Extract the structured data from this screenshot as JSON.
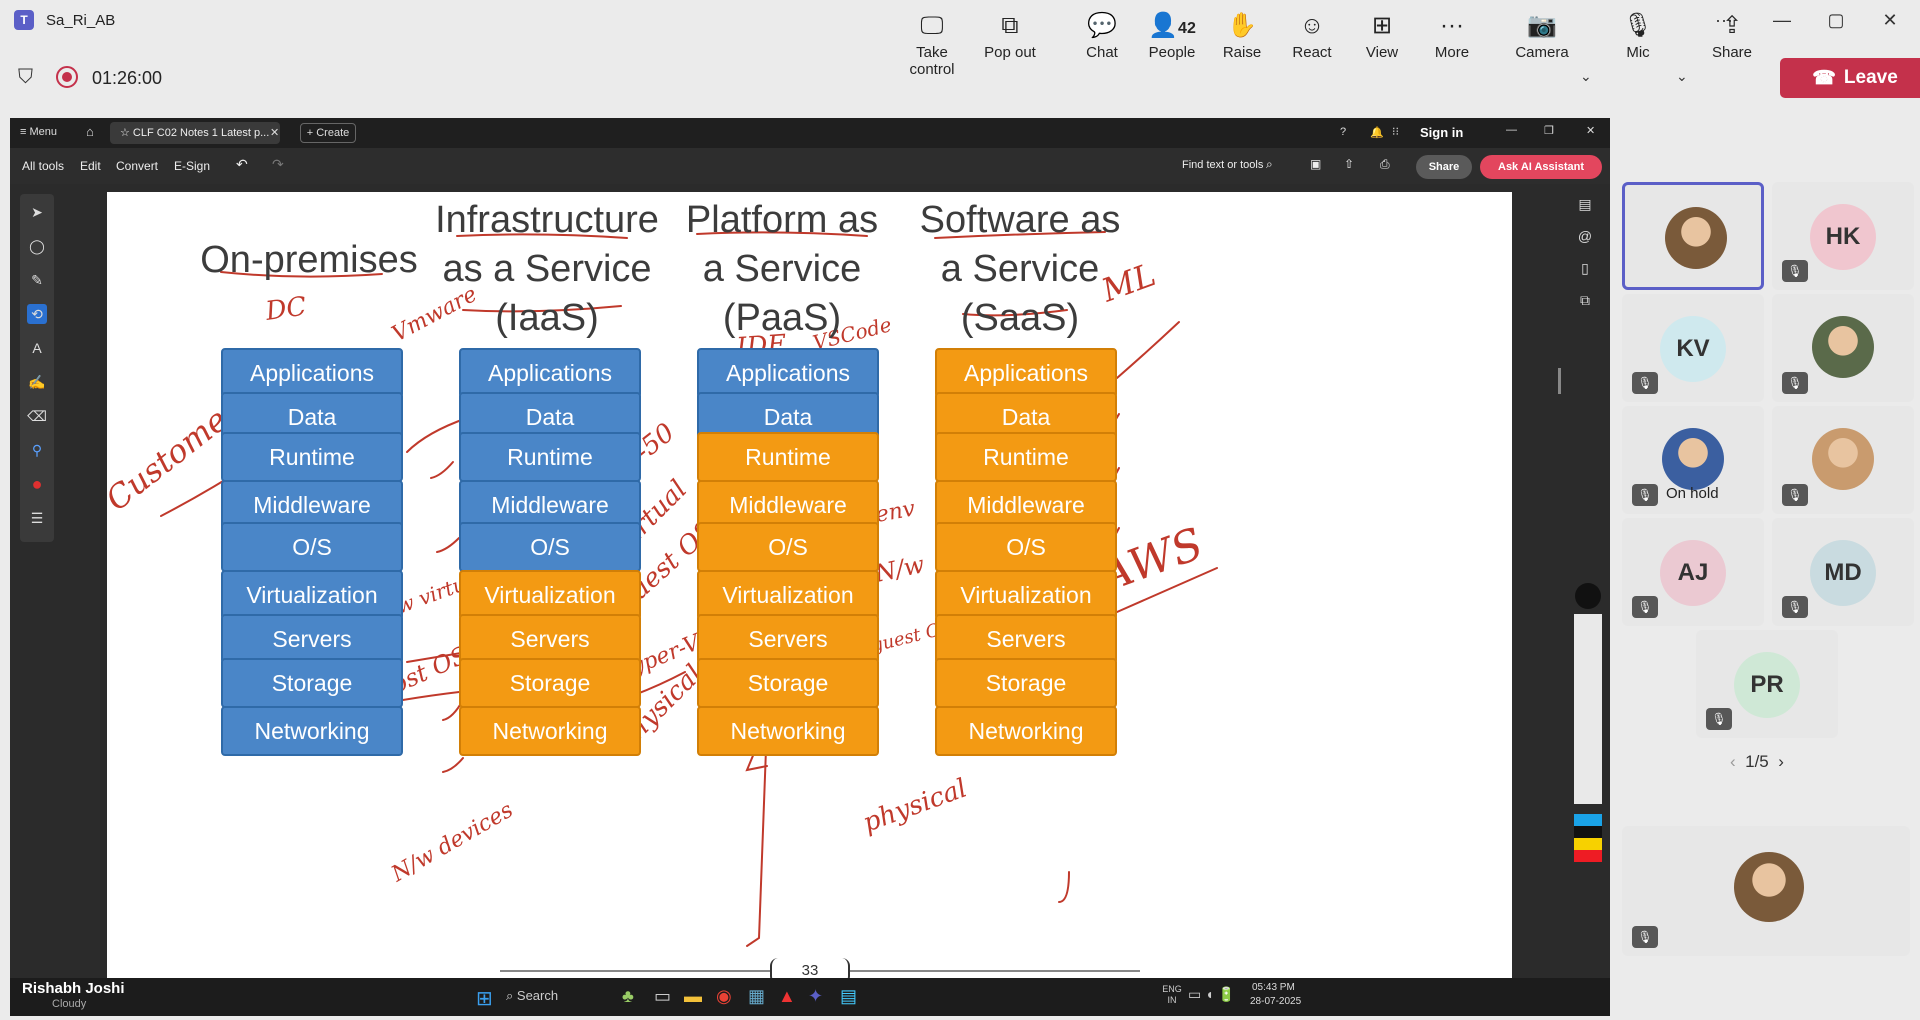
{
  "window": {
    "title": "Sa_Ri_AB",
    "min": "—",
    "max": "▢",
    "close": "✕",
    "dots": "···"
  },
  "meeting": {
    "timer": "01:26:00",
    "toolbar": [
      {
        "label": "Take control",
        "icon": "🖵"
      },
      {
        "label": "Pop out",
        "icon": "⧉"
      },
      {
        "label": "Chat",
        "icon": "💬"
      },
      {
        "label": "People",
        "icon": "👤",
        "count": "42"
      },
      {
        "label": "Raise",
        "icon": "✋"
      },
      {
        "label": "React",
        "icon": "☺"
      },
      {
        "label": "View",
        "icon": "⊞"
      },
      {
        "label": "More",
        "icon": "···"
      },
      {
        "label": "Camera",
        "icon": "📷"
      },
      {
        "label": "Mic",
        "icon": "🎙"
      },
      {
        "label": "Share",
        "icon": "⇪"
      }
    ],
    "leave_label": "Leave",
    "leave_color": "#c4314b"
  },
  "acrobat": {
    "menu_label": "Menu",
    "tab_title": "CLF C02 Notes 1 Latest p...",
    "create_label": "+ Create",
    "sign_in": "Sign in",
    "tools": [
      "All tools",
      "Edit",
      "Convert",
      "E-Sign"
    ],
    "find_placeholder": "Find text or tools",
    "share_label": "Share",
    "ai_label": "Ask AI Assistant",
    "page_number": "33"
  },
  "slide": {
    "columns": [
      {
        "title": "On-premises",
        "color": "blue"
      },
      {
        "title": "Infrastructure as a Service (IaaS)"
      },
      {
        "title": "Platform as a Service (PaaS)"
      },
      {
        "title": "Software as a Service (SaaS)"
      }
    ],
    "layers": [
      "Applications",
      "Data",
      "Runtime",
      "Middleware",
      "O/S",
      "Virtualization",
      "Servers",
      "Storage",
      "Networking"
    ],
    "colors": {
      "blue": "#4a86c8",
      "orange": "#f39a13",
      "ink": "#c0392b"
    },
    "handwriting": [
      "DC",
      "Customer",
      "Vmware",
      "50-50",
      "virtual",
      "guest OS",
      "N/w virtual",
      "Host OS",
      "Hyper-V",
      "physical",
      "N/w devices",
      "IDE",
      "VSCode",
      "env",
      "N/w",
      "guest OS",
      "physical",
      "ML",
      "AWS"
    ]
  },
  "taskbar": {
    "presenter": "Rishabh Joshi",
    "weather": "Cloudy",
    "search_placeholder": "Search",
    "lang": "ENG IN",
    "time": "05:43 PM",
    "date": "28-07-2025"
  },
  "participants": {
    "tiles": [
      {
        "initials": "",
        "status": ""
      },
      {
        "initials": "HK",
        "status": ""
      },
      {
        "initials": "KV",
        "status": ""
      },
      {
        "initials": "",
        "status": ""
      },
      {
        "initials": "",
        "status": "On hold"
      },
      {
        "initials": "",
        "status": ""
      },
      {
        "initials": "AJ",
        "status": ""
      },
      {
        "initials": "MD",
        "status": ""
      },
      {
        "initials": "PR",
        "status": ""
      },
      {
        "initials": "",
        "status": ""
      }
    ],
    "pager": "1/5"
  }
}
